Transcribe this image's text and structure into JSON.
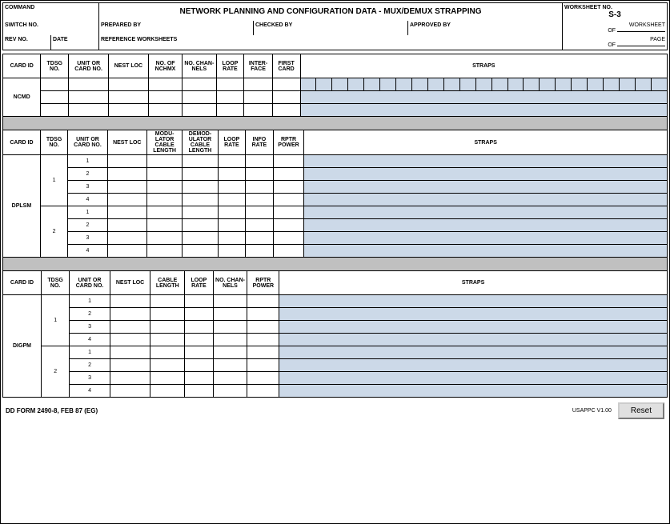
{
  "header": {
    "command_label": "COMMAND",
    "title": "NETWORK PLANNING AND CONFIGURATION DATA - MUX/DEMUX  STRAPPING",
    "worksheet_no_label": "WORKSHEET NO.",
    "worksheet_no_value": "S-3",
    "switch_no_label": "SWITCH NO.",
    "prepared_by_label": "PREPARED BY",
    "checked_by_label": "CHECKED BY",
    "approved_by_label": "APPROVED BY",
    "worksheet_label": "WORKSHEET",
    "of_label": "OF",
    "rev_no_label": "REV NO.",
    "date_label": "DATE",
    "ref_worksheets_label": "REFERENCE WORKSHEETS",
    "page_label": "PAGE",
    "of2_label": "OF"
  },
  "section1": {
    "columns": {
      "card_id": "CARD ID",
      "tdsg_no": "TDSG NO.",
      "unit_or_card_no": "UNIT OR CARD NO.",
      "nest_loc": "NEST LOC",
      "no_of_nchmx": "NO. OF NCHMX",
      "no_channels": "NO. CHAN-NELS",
      "loop_rate": "LOOP RATE",
      "interface": "INTER-FACE",
      "first_card": "FIRST CARD",
      "straps": "STRAPS"
    },
    "row_label": "NCMD",
    "data_rows": 3
  },
  "section2": {
    "columns": {
      "card_id": "CARD ID",
      "tdsg_no": "TDSG NO.",
      "unit_or_card_no": "UNIT OR CARD NO.",
      "nest_loc": "NEST LOC",
      "modu_lator_cable_length": "MODU-LATOR CABLE LENGTH",
      "demod_ulator_cable_length": "DEMOD-ULATOR CABLE LENGTH",
      "loop_rate": "LOOP RATE",
      "info_rate": "INFO RATE",
      "rptr_power": "RPTR POWER",
      "straps": "STRAPS"
    },
    "row_label": "DPLSM",
    "groups": [
      {
        "group_id": "1",
        "sub_rows": [
          "1",
          "2",
          "3",
          "4"
        ]
      },
      {
        "group_id": "2",
        "sub_rows": [
          "1",
          "2",
          "3",
          "4"
        ]
      }
    ]
  },
  "section3": {
    "columns": {
      "card_id": "CARD ID",
      "tdsg_no": "TDSG NO.",
      "unit_or_card_no": "UNIT OR CARD NO.",
      "nest_loc": "NEST LOC",
      "cable_length": "CABLE LENGTH",
      "loop_rate": "LOOP RATE",
      "no_channels": "NO. CHAN-NELS",
      "rptr_power": "RPTR POWER",
      "straps": "STRAPS"
    },
    "row_label": "DIGPM",
    "groups": [
      {
        "group_id": "1",
        "sub_rows": [
          "1",
          "2",
          "3",
          "4"
        ]
      },
      {
        "group_id": "2",
        "sub_rows": [
          "1",
          "2",
          "3",
          "4"
        ]
      }
    ]
  },
  "footer": {
    "form_number": "DD FORM 2490-8, FEB 87 (EG)",
    "version": "USAPPC V1.00",
    "reset_label": "Reset"
  }
}
